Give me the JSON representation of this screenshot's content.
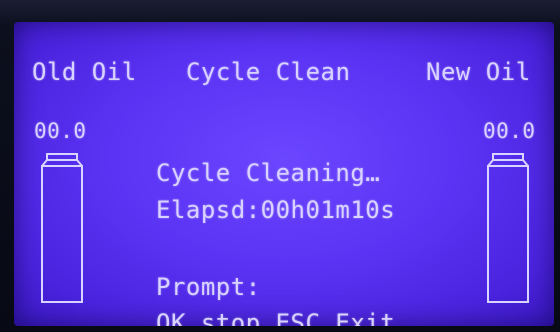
{
  "header": {
    "old_oil": "Old Oil",
    "mode": "Cycle Clean",
    "new_oil": "New Oil"
  },
  "old_tank": {
    "level_text": "00.0",
    "fill_fraction": 0.0
  },
  "new_tank": {
    "level_text": "00.0",
    "fill_fraction": 0.0
  },
  "status": {
    "line1": "Cycle Cleaning…",
    "line2": "Elapsd:00h01m10s",
    "line3": "Prompt:",
    "line4": "OK stop,ESC Exit"
  },
  "colors": {
    "screen": "#5a33f4",
    "text": "#d9d3ff"
  }
}
